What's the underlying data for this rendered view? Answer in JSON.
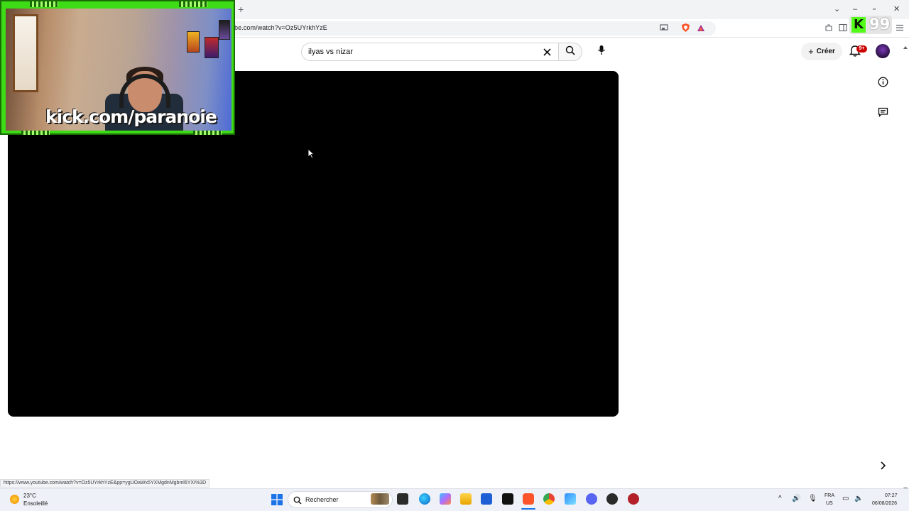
{
  "browser": {
    "new_tab_symbol": "+",
    "url": "be.com/watch?v=Oz5UYrkhYzE",
    "window_controls": {
      "minimize": "–",
      "maximize": "▫",
      "close": "✕",
      "dropdown": "⌄"
    }
  },
  "youtube": {
    "search": {
      "value": "ilyas vs nizar"
    },
    "create_label": "Créer",
    "notification_badge": "9+"
  },
  "overlay": {
    "webcam_caption": "kick.com/paranoie",
    "kick_logo": "K",
    "kick_viewer_count": "99"
  },
  "status_bar": {
    "link_url": "https://www.youtube.com/watch?v=Oz5UYrkhYzE&pp=ygUOaWx5YXMgdnMgbml6YXI%3D"
  },
  "taskbar": {
    "weather_temp": "23°C",
    "weather_desc": "Ensoleillé",
    "search_label": "Rechercher",
    "language": "FRA",
    "region": "US",
    "time": "07:27",
    "date": "06/08/2026"
  },
  "colors": {
    "kick_green": "#53fc18",
    "youtube_red": "#cc0000",
    "video_bg": "#000000"
  },
  "icons": [
    "search-icon",
    "clear-icon",
    "mic-icon",
    "plus-icon",
    "bell-icon",
    "info-icon",
    "chat-icon",
    "chevron-right-icon",
    "windows-start-icon"
  ]
}
